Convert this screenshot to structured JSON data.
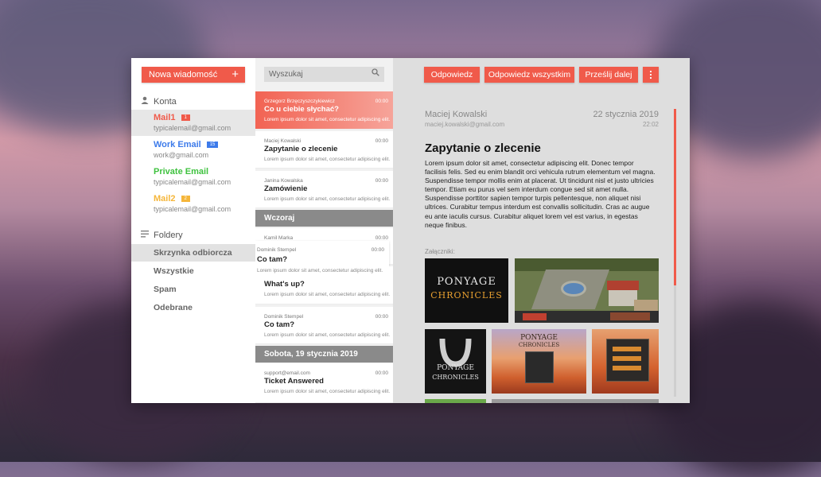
{
  "sidebar": {
    "new_message": "Nowa wiadomość",
    "new_message_icon": "plus-icon",
    "accounts_header": "Konta",
    "accounts": [
      {
        "name": "Mail1",
        "email": "typicalemail@gmail.com",
        "badge": "1",
        "color": "#f05a4a",
        "badge_color": "#f05a4a"
      },
      {
        "name": "Work Email",
        "email": "work@gmail.com",
        "badge": "15",
        "color": "#3d7bea",
        "badge_color": "#3d7bea"
      },
      {
        "name": "Private Email",
        "email": "typicalemail@gmail.com",
        "badge": "",
        "color": "#3fc23f",
        "badge_color": ""
      },
      {
        "name": "Mail2",
        "email": "typicalemail@gmail.com",
        "badge": "2",
        "color": "#f5b63a",
        "badge_color": "#f5b63a"
      }
    ],
    "folders_header": "Foldery",
    "folders": [
      "Skrzynka odbiorcza",
      "Wszystkie",
      "Spam",
      "Odebrane"
    ]
  },
  "list": {
    "search_placeholder": "Wyszukaj",
    "messages_top": [
      {
        "from": "Grzegorz Brzęczyszczykiewicz",
        "time": "00:00",
        "subject": "Co u ciebie słychać?",
        "preview": "Lorem ipsum dolor sit amet, consectetur adipiscing elit."
      },
      {
        "from": "Maciej Kowalski",
        "time": "00:00",
        "subject": "Zapytanie o zlecenie",
        "preview": "Lorem ipsum dolor sit amet, consectetur adipiscing elit."
      },
      {
        "from": "Janina Kowalska",
        "time": "00:00",
        "subject": "Zamówienie",
        "preview": "Lorem ipsum dolor sit amet, consectetur adipiscing elit."
      }
    ],
    "day_yesterday": "Wczoraj",
    "messages_yesterday": [
      {
        "from": "Kamil Marka",
        "time": "00:00",
        "subject": "",
        "preview": ""
      },
      {
        "from": "Dominik Stempel",
        "time": "00:00",
        "subject": "Co tam?",
        "preview": "Lorem ipsum dolor sit amet, consectetur adipiscing elit."
      },
      {
        "from": "",
        "time": "",
        "subject": "What's up?",
        "preview": "Lorem ipsum dolor sit amet, consectetur adipiscing elit."
      },
      {
        "from": "Dominik Stempel",
        "time": "00:00",
        "subject": "Co tam?",
        "preview": "Lorem ipsum dolor sit amet, consectetur adipiscing elit."
      }
    ],
    "day_saturday": "Sobota, 19 stycznia 2019",
    "messages_saturday": [
      {
        "from": "support@email.com",
        "time": "00:00",
        "subject": "Ticket Answered",
        "preview": "Lorem ipsum dolor sit amet, consectetur adipiscing elit."
      }
    ]
  },
  "reader": {
    "toolbar": {
      "reply": "Odpowiedz",
      "reply_all": "Odpowiedz wszystkim",
      "forward": "Prześlij dalej",
      "more_icon": "more-vertical-icon"
    },
    "from": "Maciej Kowalski",
    "email": "maciej.kowalski@gmail.com",
    "date": "22 stycznia 2019",
    "time": "22:02",
    "subject": "Zapytanie o zlecenie",
    "body": "Lorem ipsum dolor sit amet, consectetur adipiscing elit. Donec tempor facilisis felis. Sed eu enim blandit orci vehicula rutrum elementum vel magna. Suspendisse tempor mollis enim at placerat. Ut tincidunt nisl et justo ultricies tempor. Etiam eu purus vel sem interdum congue sed sit amet nulla. Suspendisse porttitor sapien tempor turpis pellentesque, non aliquet nisi ultrices. Curabitur tempus interdum est convallis sollicitudin. Cras ac augue eu ante iaculis cursus. Curabitur aliquet lorem vel est varius, in egestas neque finibus.",
    "attachments_label": "Załączniki:",
    "attachments": [
      {
        "logo_line1": "PONYAGE",
        "logo_line2": "CHRONICLES"
      },
      {
        "logo_line1": "",
        "logo_line2": ""
      },
      {
        "logo_line1": "PONYAGE",
        "logo_line2": "CHRONICLES"
      },
      {
        "logo_line1": "PONYAGE",
        "logo_line2": "CHRONICLES"
      },
      {
        "logo_line1": "",
        "logo_line2": ""
      }
    ],
    "scroll_position": 0.0
  }
}
